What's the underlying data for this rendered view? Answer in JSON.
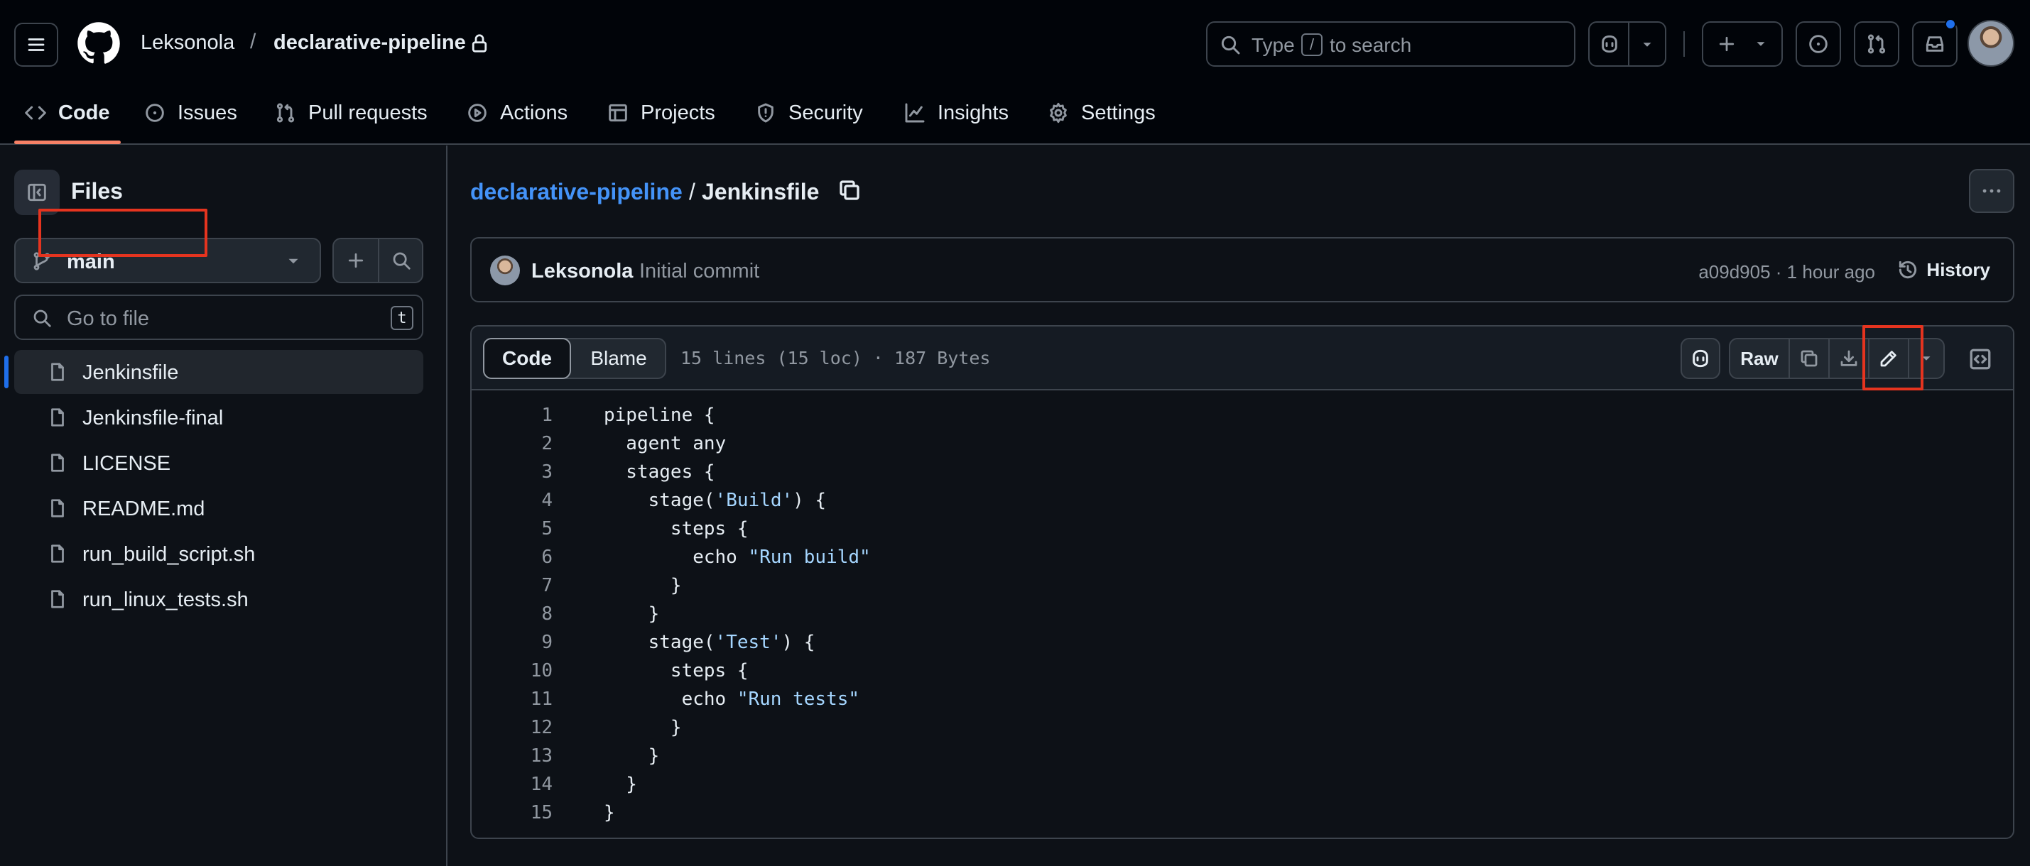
{
  "header": {
    "owner": "Leksonola",
    "separator": "/",
    "repo": "declarative-pipeline",
    "search": {
      "prefix": "Type",
      "key": "/",
      "suffix": "to search"
    }
  },
  "nav": {
    "code": "Code",
    "issues": "Issues",
    "pulls": "Pull requests",
    "actions": "Actions",
    "projects": "Projects",
    "security": "Security",
    "insights": "Insights",
    "settings": "Settings"
  },
  "sidebar": {
    "title": "Files",
    "branch": "main",
    "goto_placeholder": "Go to file",
    "goto_key": "t",
    "files": [
      "Jenkinsfile",
      "Jenkinsfile-final",
      "LICENSE",
      "README.md",
      "run_build_script.sh",
      "run_linux_tests.sh"
    ],
    "active_file": "Jenkinsfile"
  },
  "path": {
    "repo": "declarative-pipeline",
    "separator": "/",
    "file": "Jenkinsfile"
  },
  "commit": {
    "author": "Leksonola",
    "message": "Initial commit",
    "meta": "a09d905 · 1 hour ago",
    "history_label": "History"
  },
  "file_view": {
    "tab_code": "Code",
    "tab_blame": "Blame",
    "info": "15 lines (15 loc) · 187 Bytes",
    "raw_label": "Raw"
  },
  "code_lines": [
    [
      {
        "t": "pipeline {"
      }
    ],
    [
      {
        "t": "  agent any"
      }
    ],
    [
      {
        "t": "  stages {"
      }
    ],
    [
      {
        "t": "    stage("
      },
      {
        "t": "'Build'",
        "s": 1
      },
      {
        "t": ") {"
      }
    ],
    [
      {
        "t": "      steps {"
      }
    ],
    [
      {
        "t": "        echo "
      },
      {
        "t": "\"Run build\"",
        "s": 1
      }
    ],
    [
      {
        "t": "      }"
      }
    ],
    [
      {
        "t": "    }"
      }
    ],
    [
      {
        "t": "    stage("
      },
      {
        "t": "'Test'",
        "s": 1
      },
      {
        "t": ") {"
      }
    ],
    [
      {
        "t": "      steps {"
      }
    ],
    [
      {
        "t": "       echo "
      },
      {
        "t": "\"Run tests\"",
        "s": 1
      }
    ],
    [
      {
        "t": "      }"
      }
    ],
    [
      {
        "t": "    }"
      }
    ],
    [
      {
        "t": "  }"
      }
    ],
    [
      {
        "t": "}"
      }
    ]
  ],
  "colors": {
    "accent": "#4493f8",
    "nav_underline": "#f78166",
    "highlight": "#e5341f",
    "string": "#a5d6ff"
  }
}
